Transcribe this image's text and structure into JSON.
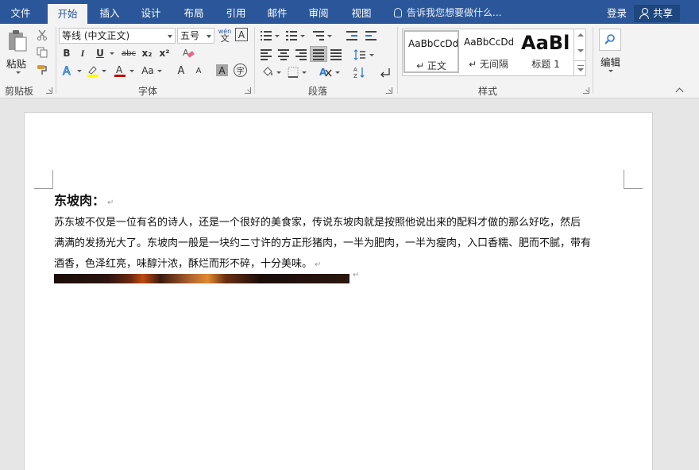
{
  "tabs": [
    "文件",
    "开始",
    "插入",
    "设计",
    "布局",
    "引用",
    "邮件",
    "审阅",
    "视图"
  ],
  "active_tab": "开始",
  "tell_me": "告诉我您想要做什么...",
  "login": "登录",
  "share": "共享",
  "clipboard": {
    "paste": "粘贴",
    "label": "剪贴板"
  },
  "font": {
    "name": "等线 (中文正文)",
    "size": "五号",
    "label": "字体",
    "bold": "B",
    "italic": "I",
    "underline": "U",
    "strike": "abc",
    "sub": "x₂",
    "sup": "x²",
    "case": "Aa",
    "grow": "A",
    "shrink": "A",
    "shade": "A",
    "phonetic": "wén",
    "enclose": "字"
  },
  "paragraph": {
    "label": "段落"
  },
  "styles": {
    "label": "样式",
    "items": [
      {
        "sample": "AaBbCcDd",
        "name": "↵ 正文"
      },
      {
        "sample": "AaBbCcDd",
        "name": "↵ 无间隔"
      },
      {
        "sample": "AaBl",
        "name": "标题 1"
      }
    ]
  },
  "editing": {
    "label": "编辑"
  },
  "document": {
    "heading": "东坡肉：",
    "body_lines": [
      "苏东坡不仅是一位有名的诗人，还是一个很好的美食家，传说东坡肉就是按照他说出来的配料才做的那么好吃，然后",
      "满满的发扬光大了。东坡肉一般是一块约二寸许的方正形猪肉，一半为肥肉，一半为瘦肉，入口香糯、肥而不腻，带有",
      "酒香，色泽红亮，味醇汁浓，酥烂而形不碎，十分美味。"
    ],
    "para_mark": "↵"
  },
  "colors": {
    "tab_bar": "#2b579a",
    "highlight": "#ffff00",
    "font_color": "#c00000"
  }
}
